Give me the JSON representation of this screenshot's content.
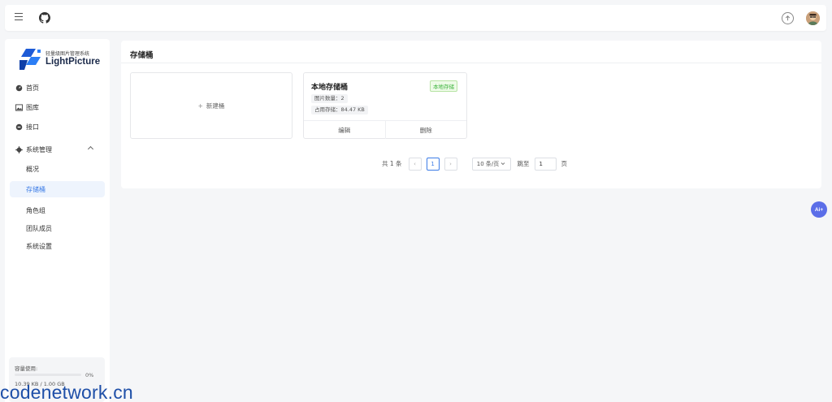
{
  "header": {
    "menu_icon": "hamburger-icon",
    "github_icon": "github-icon",
    "upload_icon": "upload-icon",
    "avatar": "user-avatar"
  },
  "sidebar": {
    "logo": {
      "subtitle": "轻量级图片管理系统",
      "name": "LightPicture"
    },
    "items": [
      {
        "label": "首页",
        "icon": "dashboard-icon"
      },
      {
        "label": "图库",
        "icon": "gallery-icon"
      },
      {
        "label": "接口",
        "icon": "api-icon"
      }
    ],
    "group": {
      "label": "系统管理",
      "icon": "gear-icon",
      "children": [
        {
          "label": "概况",
          "active": false
        },
        {
          "label": "存储桶",
          "active": true
        },
        {
          "label": "角色组",
          "active": false
        },
        {
          "label": "团队成员",
          "active": false
        },
        {
          "label": "系统设置",
          "active": false
        }
      ]
    },
    "usage": {
      "label": "容量使用:",
      "percent": "0%",
      "fraction": 0,
      "size": "10.39 KB / 1.00 GB"
    }
  },
  "main": {
    "title": "存储桶",
    "new_card": {
      "plus": "+",
      "label": "新建桶"
    },
    "bucket": {
      "name": "本地存储桶",
      "badge": "本地存储",
      "image_count": "图片数量：2",
      "storage_used": "占用存储：84.47 KB",
      "edit_label": "编辑",
      "delete_label": "删除"
    },
    "pagination": {
      "total": "共 1 条",
      "prev": "‹",
      "current": "1",
      "next": "›",
      "page_size": "10 条/页",
      "goto_label": "跳至",
      "goto_value": "1",
      "page_unit": "页"
    }
  },
  "ai_button": {
    "label": "Ai+"
  },
  "watermark": "codenetwork.cn",
  "colors": {
    "accent": "#3c7ce6",
    "badge_green": "#3cb33c",
    "ai_button": "#5b6ee8"
  }
}
